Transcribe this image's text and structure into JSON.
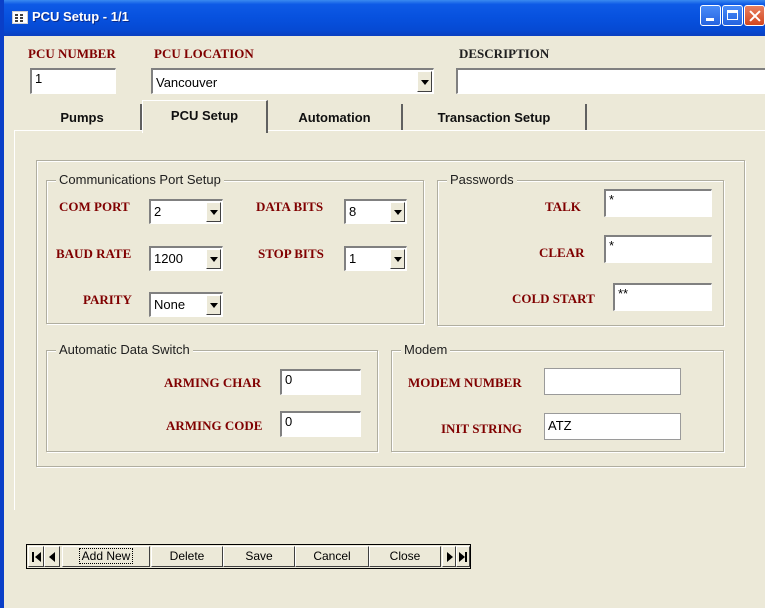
{
  "window": {
    "title": "PCU Setup - 1/1"
  },
  "header": {
    "pcu_number_label": "PCU NUMBER",
    "pcu_number_value": "1",
    "pcu_location_label": "PCU LOCATION",
    "pcu_location_value": "Vancouver",
    "description_label": "DESCRIPTION",
    "description_value": ""
  },
  "tabs": [
    {
      "label": "Pumps",
      "active": false
    },
    {
      "label": "PCU Setup",
      "active": true
    },
    {
      "label": "Automation",
      "active": false
    },
    {
      "label": "Transaction Setup",
      "active": false
    }
  ],
  "comm_port": {
    "title": "Communications Port Setup",
    "com_port_label": "COM PORT",
    "com_port_value": "2",
    "baud_rate_label": "BAUD RATE",
    "baud_rate_value": "1200",
    "parity_label": "PARITY",
    "parity_value": "None",
    "data_bits_label": "DATA BITS",
    "data_bits_value": "8",
    "stop_bits_label": "STOP BITS",
    "stop_bits_value": "1"
  },
  "passwords": {
    "title": "Passwords",
    "talk_label": "TALK",
    "talk_value": "*",
    "clear_label": "CLEAR",
    "clear_value": "*",
    "cold_start_label": "COLD START",
    "cold_start_value": "**"
  },
  "data_switch": {
    "title": "Automatic Data Switch",
    "arming_char_label": "ARMING CHAR",
    "arming_char_value": "0",
    "arming_code_label": "ARMING CODE",
    "arming_code_value": "0"
  },
  "modem": {
    "title": "Modem",
    "modem_number_label": "MODEM NUMBER",
    "modem_number_value": "",
    "init_string_label": "INIT STRING",
    "init_string_value": "ATZ"
  },
  "navigation": {
    "add_new": "Add New",
    "delete": "Delete",
    "save": "Save",
    "cancel": "Cancel",
    "close": "Close",
    "icons": [
      "first-record-icon",
      "previous-record-icon",
      "next-record-icon",
      "last-record-icon"
    ]
  },
  "colors": {
    "titlebar": "#0751de",
    "label_maroon": "#800000",
    "window_face": "#ece9d8"
  }
}
